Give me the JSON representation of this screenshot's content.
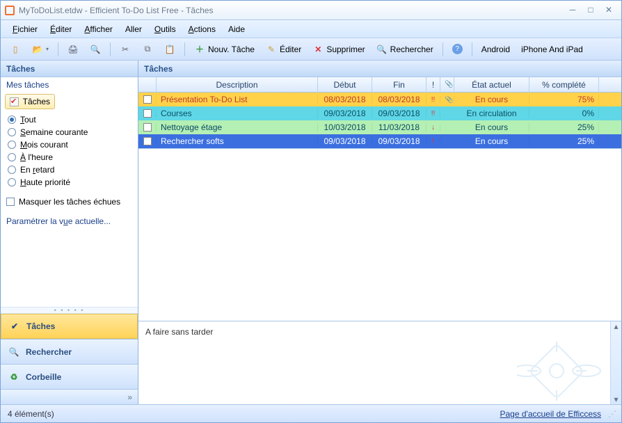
{
  "window": {
    "title": "MyToDoList.etdw - Efficient To-Do List Free - Tâches"
  },
  "menu": {
    "file": "Fichier",
    "file_u": "F",
    "edit": "Éditer",
    "edit_u": "É",
    "view": "Afficher",
    "view_u": "A",
    "go": "Aller",
    "go_pre": "A",
    "go_rest": "ller",
    "tools": "Outils",
    "tools_u": "O",
    "actions": "Actions",
    "actions_u": "A",
    "help": "Aide",
    "help_pre": "A",
    "help_rest": "ide"
  },
  "toolbar": {
    "new_task": "Nouv. Tâche",
    "edit": "Éditer",
    "delete": "Supprimer",
    "search": "Rechercher",
    "android": "Android",
    "iphone": "iPhone And iPad"
  },
  "sidebar": {
    "header": "Tâches",
    "my_tasks": "Mes tâches",
    "tasks_tab": "Tâches",
    "filters": {
      "all": "Tout",
      "all_u": "T",
      "all_rest": "out",
      "week": "Semaine courante",
      "week_u": "S",
      "month": "Mois courant",
      "month_u": "M",
      "ontime": "À l'heure",
      "ontime_u": "À",
      "late": "En retard",
      "late_u": "r",
      "late_pre": "En ",
      "high": "Haute priorité",
      "high_u": "H"
    },
    "hide_due": "Masquer les tâches échues",
    "param_view": "Paramétrer la vue actuelle...",
    "nav": {
      "tasks": "Tâches",
      "search": "Rechercher",
      "recycle": "Corbeille"
    }
  },
  "content": {
    "header": "Tâches",
    "columns": {
      "description": "Description",
      "start": "Début",
      "end": "Fin",
      "priority": "!",
      "attach": "📎",
      "state": "État actuel",
      "pct": "% complété"
    },
    "rows": [
      {
        "desc": "Présentation To-Do List",
        "start": "08/03/2018",
        "end": "08/03/2018",
        "pri": "!!",
        "att": "📎",
        "state": "En cours",
        "pct": "75%",
        "cls": "row-yellow"
      },
      {
        "desc": "Courses",
        "start": "09/03/2018",
        "end": "09/03/2018",
        "pri": "!!",
        "att": "",
        "state": "En circulation",
        "pct": "0%",
        "cls": "row-cyan"
      },
      {
        "desc": "Nettoyage étage",
        "start": "10/03/2018",
        "end": "11/03/2018",
        "pri": "↓",
        "att": "",
        "state": "En cours",
        "pct": "25%",
        "cls": "row-green"
      },
      {
        "desc": "Rechercher softs",
        "start": "09/03/2018",
        "end": "09/03/2018",
        "pri": "!",
        "att": "",
        "state": "En cours",
        "pct": "25%",
        "cls": "row-blue"
      }
    ],
    "note": "A faire sans tarder"
  },
  "status": {
    "count": "4 élément(s)",
    "link": "Page d'accueil de Efficcess"
  }
}
